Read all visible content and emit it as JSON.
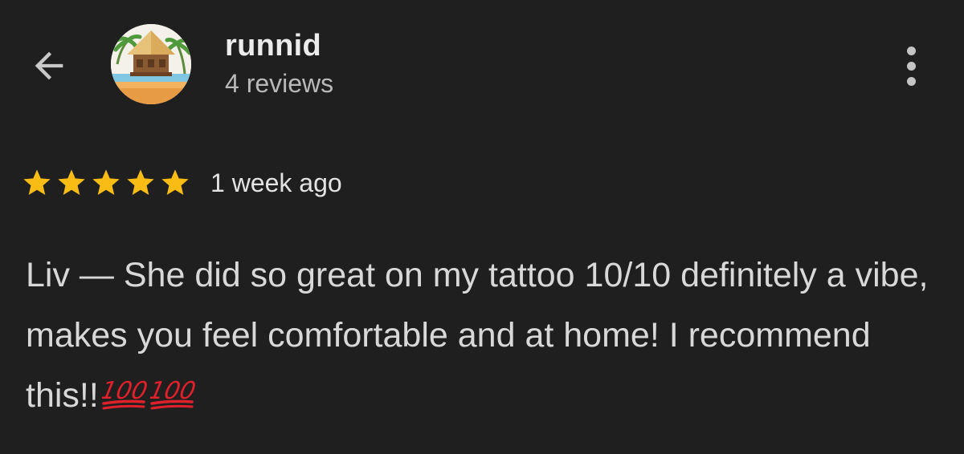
{
  "header": {
    "reviewer_name": "runnid",
    "review_count": "4 reviews"
  },
  "icons": {
    "back": "back-arrow-icon",
    "avatar": "beach-hut-avatar",
    "more": "more-vert-icon",
    "star": "star-icon",
    "emoji": "hundred-points-emoji"
  },
  "review": {
    "rating": 5,
    "max_rating": 5,
    "time": "1 week ago",
    "text": "Liv — She did so great on my tattoo 10/10 definitely a vibe, makes you feel comfortable and at home! I recommend this!!",
    "emojis": [
      "💯",
      "💯"
    ]
  },
  "colors": {
    "background": "#1f1f1f",
    "star": "#f9bc15",
    "text": "#d8d8d8",
    "emoji": "#e0202a"
  }
}
